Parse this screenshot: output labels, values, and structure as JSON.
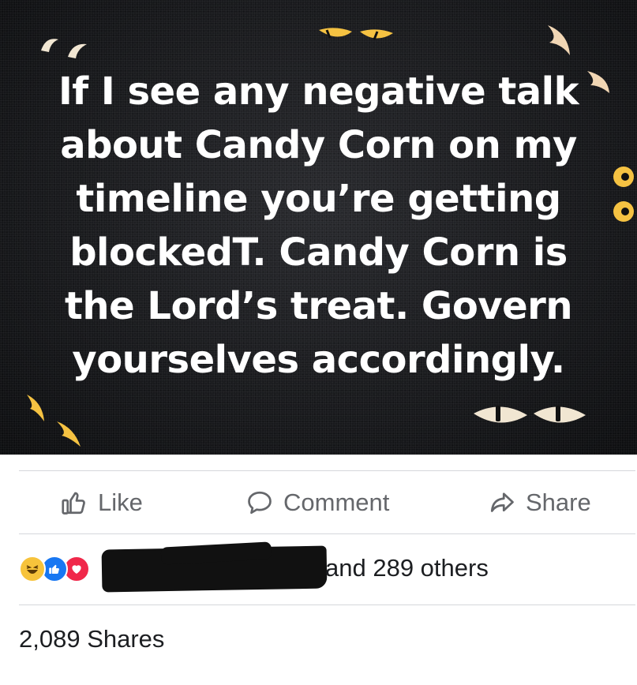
{
  "post": {
    "text_lines": [
      "If I see any negative talk",
      "about Candy Corn on my",
      "timeline you’re getting",
      "blockedT. Candy Corn is",
      "the Lord’s treat.  Govern",
      "yourselves accordingly."
    ],
    "background_color": "#1a1b1e",
    "decoration_color": "#f5c242"
  },
  "actions": {
    "like_label": "Like",
    "comment_label": "Comment",
    "share_label": "Share",
    "icons": [
      "thumbs-up-icon",
      "comment-bubble-icon",
      "share-arrow-icon"
    ],
    "color": "#65676b"
  },
  "reactions": {
    "icons": [
      "haha-reaction-icon",
      "like-reaction-icon",
      "love-reaction-icon"
    ],
    "summary_text": "and 289 others"
  },
  "shares": {
    "label": "2,089 Shares"
  }
}
